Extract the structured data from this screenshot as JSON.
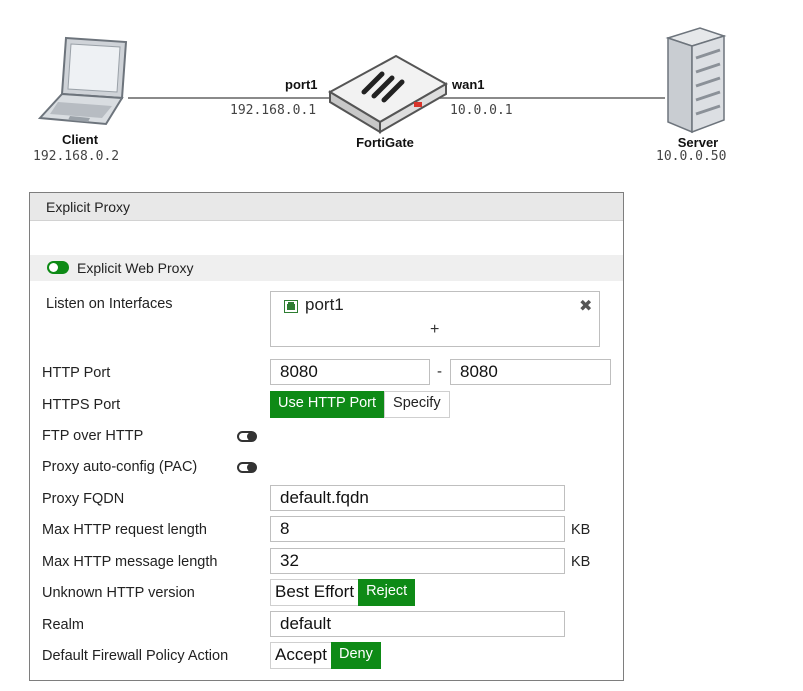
{
  "topology": {
    "client": {
      "name": "Client",
      "ip": "192.168.0.2"
    },
    "fortigate": {
      "name": "FortiGate"
    },
    "server": {
      "name": "Server",
      "ip": "10.0.0.50"
    },
    "port1": {
      "name": "port1",
      "ip": "192.168.0.1"
    },
    "wan1": {
      "name": "wan1",
      "ip": "10.0.0.1"
    }
  },
  "panel": {
    "title": "Explicit Proxy",
    "toggle_label": "Explicit Web Proxy",
    "labels": {
      "listen": "Listen on Interfaces",
      "http_port": "HTTP Port",
      "https_port": "HTTPS Port",
      "ftp": "FTP over HTTP",
      "pac": "Proxy auto-config (PAC)",
      "fqdn": "Proxy FQDN",
      "max_req": "Max HTTP request length",
      "max_msg": "Max HTTP message length",
      "unknown_ver": "Unknown HTTP version",
      "realm": "Realm",
      "default_action": "Default Firewall Policy Action"
    },
    "listen_interface": "port1",
    "add_symbol": "+",
    "remove_symbol": "✖",
    "http_port_from": "8080",
    "http_port_sep": "-",
    "http_port_to": "8080",
    "https_opt_use": "Use HTTP Port",
    "https_opt_specify": "Specify",
    "fqdn": "default.fqdn",
    "max_req": "8",
    "max_msg": "32",
    "kb_unit": "KB",
    "unknown_opt_best": "Best Effort",
    "unknown_opt_reject": "Reject",
    "realm": "default",
    "action_accept": "Accept",
    "action_deny": "Deny",
    "accent": "#0e8a16"
  }
}
